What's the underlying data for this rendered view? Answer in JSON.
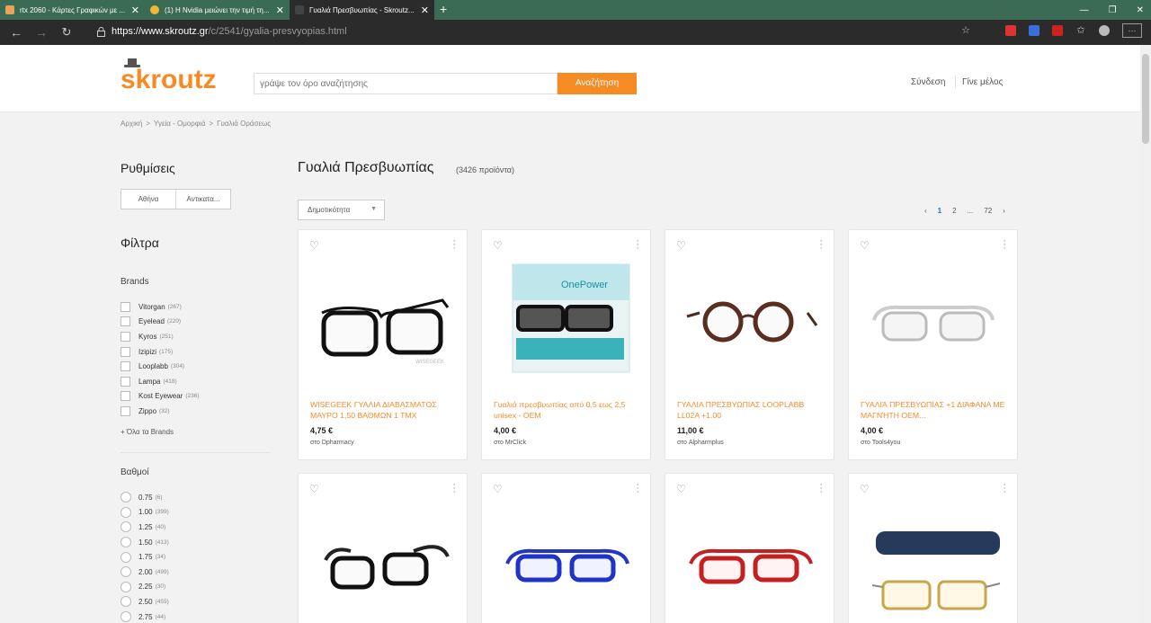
{
  "browser": {
    "tabs": [
      {
        "title": "rtx 2060 - Κάρτες Γραφικών με ...",
        "fav": "#e8a35a"
      },
      {
        "title": "(1) Η Nvidia μειώνει την τιμή τη...",
        "fav": "#f0b830"
      },
      {
        "title": "Γυαλιά Πρεσβυωπίας - Skroutz...",
        "fav": "#444444"
      }
    ],
    "url_host": "https://www.skroutz.gr",
    "url_path": "/c/2541/gyalia-presvyopias.html"
  },
  "header": {
    "logo": "skroutz",
    "search_placeholder": "γράψε τον όρο αναζήτησης",
    "search_button": "Αναζήτηση",
    "login": "Σύνδεση",
    "join": "Γίνε μέλος"
  },
  "breadcrumb": [
    "Αρχική",
    ">",
    "Υγεία - Ομορφιά",
    ">",
    "Γυαλιά Οράσεως"
  ],
  "sidebar": {
    "settings_title": "Ρυθμίσεις",
    "location": "Αθήνα",
    "location_alt": "Αντικατα...",
    "filters_title": "Φίλτρα",
    "brands_title": "Brands",
    "brands": [
      {
        "name": "Vitorgan",
        "count": "(267)"
      },
      {
        "name": "Eyelead",
        "count": "(220)"
      },
      {
        "name": "Kyros",
        "count": "(251)"
      },
      {
        "name": "Izipizi",
        "count": "(175)"
      },
      {
        "name": "Looplabb",
        "count": "(304)"
      },
      {
        "name": "Lampa",
        "count": "(418)"
      },
      {
        "name": "Kost Eyewear",
        "count": "(236)"
      },
      {
        "name": "Zippo",
        "count": "(32)"
      }
    ],
    "all_brands": "+  Όλα τα Brands",
    "grades_title": "Βαθμοί",
    "grades": [
      {
        "name": "0.75",
        "count": "(6)"
      },
      {
        "name": "1.00",
        "count": "(399)"
      },
      {
        "name": "1.25",
        "count": "(40)"
      },
      {
        "name": "1.50",
        "count": "(413)"
      },
      {
        "name": "1.75",
        "count": "(34)"
      },
      {
        "name": "2.00",
        "count": "(499)"
      },
      {
        "name": "2.25",
        "count": "(30)"
      },
      {
        "name": "2.50",
        "count": "(455)"
      },
      {
        "name": "2.75",
        "count": "(44)"
      }
    ]
  },
  "main": {
    "title": "Γυαλιά Πρεσβυωπίας",
    "count": "(3426 προϊόντα)",
    "sort": "Δημοτικότητα",
    "pager": {
      "prev": "‹",
      "p1": "1",
      "p2": "2",
      "dots": "...",
      "last": "72",
      "next": "›"
    },
    "products": [
      {
        "name": "WISEGEEK ΓΥΑΛΙΑ ΔΙΑΒΑΣΜΑΤΟΣ ΜΑΥΡΟ 1,50 ΒΑΘΜΩΝ 1 ΤΜΧ",
        "price": "4,75 €",
        "shop": "στο Dpharmacy",
        "img_caption": "WISEGEEK"
      },
      {
        "name": "Γυαλιά πρεσβυωπίας από 0,5 εως 2,5 unisex - OEM",
        "price": "4,00 €",
        "shop": "στο MrClick",
        "img_caption": "OnePower"
      },
      {
        "name": "ΓΥΑΛΙΑ ΠΡΕΣΒΥΩΠΙΑΣ LOOPLABB LL02A +1.00",
        "price": "11,00 €",
        "shop": "στο Alpharmplus"
      },
      {
        "name": "ΓΥΑΛΙΆ ΠΡΕΣΒΥΩΠΙΑΣ +1 ΔΙΆΦΑΝΑ ΜΕ ΜΑΓΝΉΤΗ OEM...",
        "price": "4,00 €",
        "shop": "στο Tools4you"
      },
      {
        "name": "",
        "price": "",
        "shop": ""
      },
      {
        "name": "",
        "price": "",
        "shop": ""
      },
      {
        "name": "",
        "price": "",
        "shop": ""
      },
      {
        "name": "",
        "price": "",
        "shop": ""
      }
    ]
  },
  "colors": {
    "accent": "#f68b24",
    "link_blue": "#1a6fc9",
    "tabbar": "#3c6b55"
  }
}
